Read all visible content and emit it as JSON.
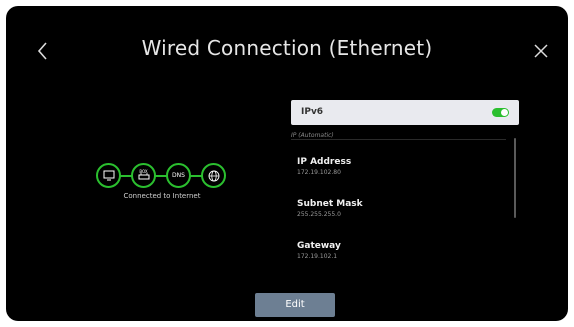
{
  "header": {
    "title": "Wired Connection (Ethernet)"
  },
  "status": {
    "connected_text": "Connected to Internet",
    "nodes": [
      {
        "icon": "tv-icon"
      },
      {
        "icon": "router-icon",
        "label": "BOX"
      },
      {
        "icon": "dns-icon",
        "label": "DNS"
      },
      {
        "icon": "globe-icon"
      }
    ],
    "color": "#2bbf2f"
  },
  "ipv6": {
    "label": "IPv6",
    "enabled": true
  },
  "ip_settings": {
    "caption": "IP (Automatic)",
    "items": [
      {
        "label": "IP Address",
        "value": "172.19.102.80"
      },
      {
        "label": "Subnet Mask",
        "value": "255.255.255.0"
      },
      {
        "label": "Gateway",
        "value": "172.19.102.1"
      }
    ]
  },
  "actions": {
    "edit_label": "Edit"
  }
}
